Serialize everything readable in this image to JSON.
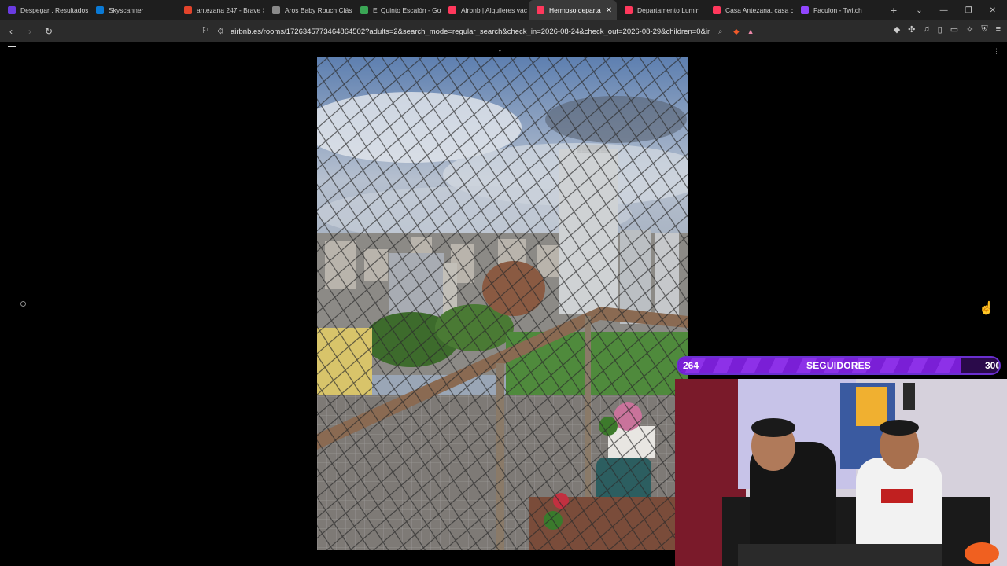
{
  "tabs": [
    {
      "title": "Despegar . Resultados",
      "color": "#6a3be0",
      "active": false
    },
    {
      "title": "Skyscanner",
      "color": "#0a7ad6",
      "active": false
    },
    {
      "title": "antezana 247 - Brave S",
      "color": "#e3442b",
      "active": false
    },
    {
      "title": "Aros Baby Rouch Clás",
      "color": "#8a8a8a",
      "active": false
    },
    {
      "title": "El Quinto Escalón - Go",
      "color": "#3aa655",
      "active": false
    },
    {
      "title": "Airbnb | Alquileres vac",
      "color": "#ff385c",
      "active": false
    },
    {
      "title": "Hermoso departa",
      "color": "#ff385c",
      "active": true
    },
    {
      "title": "Departamento Lumin",
      "color": "#ff385c",
      "active": false
    },
    {
      "title": "Casa Antezana, casa c",
      "color": "#ff385c",
      "active": false
    },
    {
      "title": "Faculon - Twitch",
      "color": "#9146ff",
      "active": false
    }
  ],
  "new_tab_icon": "plus-icon",
  "url": "airbnb.es/rooms/1726345773464864502?adults=2&search_mode=regular_search&check_in=2026-08-24&check_out=2026-08-29&children=0&inf...",
  "follower_goal": {
    "current": "264",
    "label": "SEGUIDORES",
    "target": "300",
    "progress": 0.88
  },
  "colors": {
    "accent": "#7a1fd6",
    "tab_bar": "#1e1e1e",
    "toolbar": "#2b2b2b"
  }
}
